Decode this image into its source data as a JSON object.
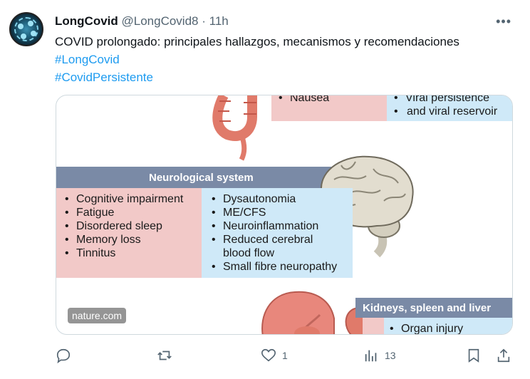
{
  "tweet": {
    "author_name": "LongCovid",
    "handle": "@LongCovid8",
    "separator": "·",
    "time": "11h",
    "more_icon": "more-horizontal-icon",
    "text_line": "COVID prolongado: principales hallazgos, mecanismos y recomendaciones",
    "hashtags": [
      "#LongCovid",
      "#CovidPersistente"
    ],
    "link_color": "#1d9bf0"
  },
  "media": {
    "top_left_item": "Nausea",
    "top_right_items": [
      "Viral persistence",
      "and viral reservoir"
    ],
    "neuro_band": "Neurological system",
    "neuro_left": [
      "Cognitive impairment",
      "Fatigue",
      "Disordered sleep",
      "Memory loss",
      "Tinnitus"
    ],
    "neuro_right": [
      "Dysautonomia",
      "ME/CFS",
      "Neuroinflammation",
      "Reduced cerebral",
      "blood flow",
      "Small fibre neuropathy"
    ],
    "kidney_band": "Kidneys, spleen and liver",
    "kidney_item": "Organ injury",
    "watermark": "nature.com",
    "colors": {
      "pink": "#f2c9c8",
      "blue": "#cfe9f8",
      "band": "#7a8aa6"
    }
  },
  "actions": {
    "reply_icon": "reply-icon",
    "retweet_icon": "retweet-icon",
    "like_icon": "heart-icon",
    "like_count": "1",
    "views_icon": "views-chart-icon",
    "views_count": "13",
    "bookmark_icon": "bookmark-icon",
    "share_icon": "share-icon"
  }
}
